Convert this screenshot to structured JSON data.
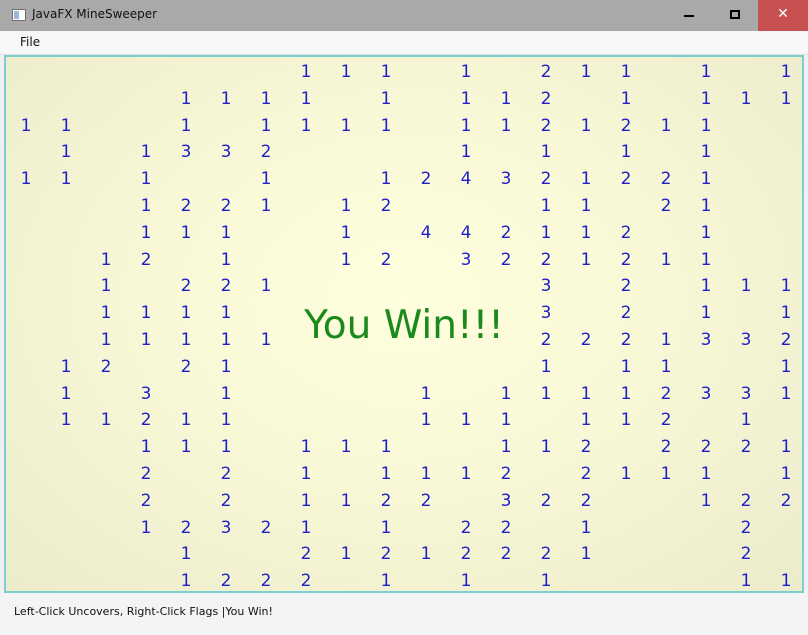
{
  "window": {
    "title": "JavaFX MineSweeper",
    "icon": "app-window-icon",
    "controls": {
      "minimize": "minimize-icon",
      "maximize": "maximize-icon",
      "close": "✕"
    }
  },
  "menubar": {
    "items": [
      "File"
    ]
  },
  "board": {
    "win_message": "You Win!!!",
    "number_color": "#2020c8",
    "message_color": "#1a8a1a",
    "rows": [
      [
        "",
        "",
        "",
        "",
        "",
        "",
        "",
        "1",
        "1",
        "1",
        "",
        "1",
        "",
        "2",
        "1",
        "1",
        "",
        "1",
        "",
        "1"
      ],
      [
        "",
        "",
        "",
        "",
        "1",
        "1",
        "1",
        "1",
        "",
        "1",
        "",
        "1",
        "1",
        "2",
        "",
        "1",
        "",
        "1",
        "1",
        "1"
      ],
      [
        "1",
        "1",
        "",
        "",
        "1",
        "",
        "1",
        "1",
        "1",
        "1",
        "",
        "1",
        "1",
        "2",
        "1",
        "2",
        "1",
        "1",
        "",
        ""
      ],
      [
        "",
        "1",
        "",
        "1",
        "3",
        "3",
        "2",
        "",
        "",
        "",
        "",
        "1",
        "",
        "1",
        "",
        "1",
        "",
        "1",
        "",
        ""
      ],
      [
        "1",
        "1",
        "",
        "1",
        "",
        "",
        "1",
        "",
        "",
        "1",
        "2",
        "4",
        "3",
        "2",
        "1",
        "2",
        "2",
        "1",
        "",
        ""
      ],
      [
        "",
        "",
        "",
        "1",
        "2",
        "2",
        "1",
        "",
        "1",
        "2",
        "",
        "",
        "",
        "1",
        "1",
        "",
        "2",
        "1",
        "",
        ""
      ],
      [
        "",
        "",
        "",
        "1",
        "1",
        "1",
        "",
        "",
        "1",
        "",
        "4",
        "4",
        "2",
        "1",
        "1",
        "2",
        "",
        "1",
        "",
        ""
      ],
      [
        "",
        "",
        "1",
        "2",
        "",
        "1",
        "",
        "",
        "1",
        "2",
        "",
        "3",
        "2",
        "2",
        "1",
        "2",
        "1",
        "1",
        "",
        ""
      ],
      [
        "",
        "",
        "1",
        "",
        "2",
        "2",
        "1",
        "",
        "",
        "",
        "",
        "",
        "",
        "3",
        "",
        "2",
        "",
        "1",
        "1",
        "1"
      ],
      [
        "",
        "",
        "1",
        "1",
        "1",
        "1",
        "",
        "",
        "",
        "",
        "",
        "",
        "",
        "3",
        "",
        "2",
        "",
        "1",
        "",
        "1"
      ],
      [
        "",
        "",
        "1",
        "1",
        "1",
        "1",
        "1",
        "",
        "",
        "",
        "",
        "",
        "",
        "2",
        "2",
        "2",
        "1",
        "3",
        "3",
        "2"
      ],
      [
        "",
        "1",
        "2",
        "",
        "2",
        "1",
        "",
        "",
        "",
        "",
        "",
        "",
        "",
        "1",
        "",
        "1",
        "1",
        "",
        "",
        "1"
      ],
      [
        "",
        "1",
        "",
        "3",
        "",
        "1",
        "",
        "",
        "",
        "",
        "1",
        "",
        "1",
        "1",
        "1",
        "1",
        "2",
        "3",
        "3",
        "1"
      ],
      [
        "",
        "1",
        "1",
        "2",
        "1",
        "1",
        "",
        "",
        "",
        "",
        "1",
        "1",
        "1",
        "",
        "1",
        "1",
        "2",
        "",
        "1",
        ""
      ],
      [
        "",
        "",
        "",
        "1",
        "1",
        "1",
        "",
        "1",
        "1",
        "1",
        "",
        "",
        "1",
        "1",
        "2",
        "",
        "2",
        "2",
        "2",
        "1"
      ],
      [
        "",
        "",
        "",
        "2",
        "",
        "2",
        "",
        "1",
        "",
        "1",
        "1",
        "1",
        "2",
        "",
        "2",
        "1",
        "1",
        "1",
        "",
        "1"
      ],
      [
        "",
        "",
        "",
        "2",
        "",
        "2",
        "",
        "1",
        "1",
        "2",
        "2",
        "",
        "3",
        "2",
        "2",
        "",
        "",
        "1",
        "2",
        "2"
      ],
      [
        "",
        "",
        "",
        "1",
        "2",
        "3",
        "2",
        "1",
        "",
        "1",
        "",
        "2",
        "2",
        "",
        "1",
        "",
        "",
        "",
        "2",
        ""
      ],
      [
        "",
        "",
        "",
        "",
        "1",
        "",
        "",
        "2",
        "1",
        "2",
        "1",
        "2",
        "2",
        "2",
        "1",
        "",
        "",
        "",
        "2",
        ""
      ],
      [
        "",
        "",
        "",
        "",
        "1",
        "2",
        "2",
        "2",
        "",
        "1",
        "",
        "1",
        "",
        "1",
        "",
        "",
        "",
        "",
        "1",
        "1"
      ]
    ]
  },
  "status": {
    "text": "Left-Click Uncovers, Right-Click Flags |You Win!"
  }
}
